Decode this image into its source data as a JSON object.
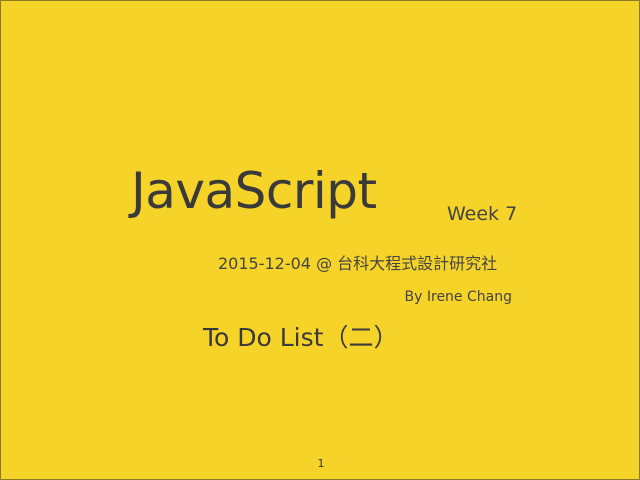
{
  "slide": {
    "title": "JavaScript",
    "week": "Week 7",
    "date_line": "2015-12-04 @ 台科大程式設計研究社",
    "author": "By Irene Chang",
    "subtitle": "To Do List（二）",
    "page_number": "1"
  },
  "colors": {
    "background": "#F5D328",
    "text": "#3a3a3a"
  }
}
